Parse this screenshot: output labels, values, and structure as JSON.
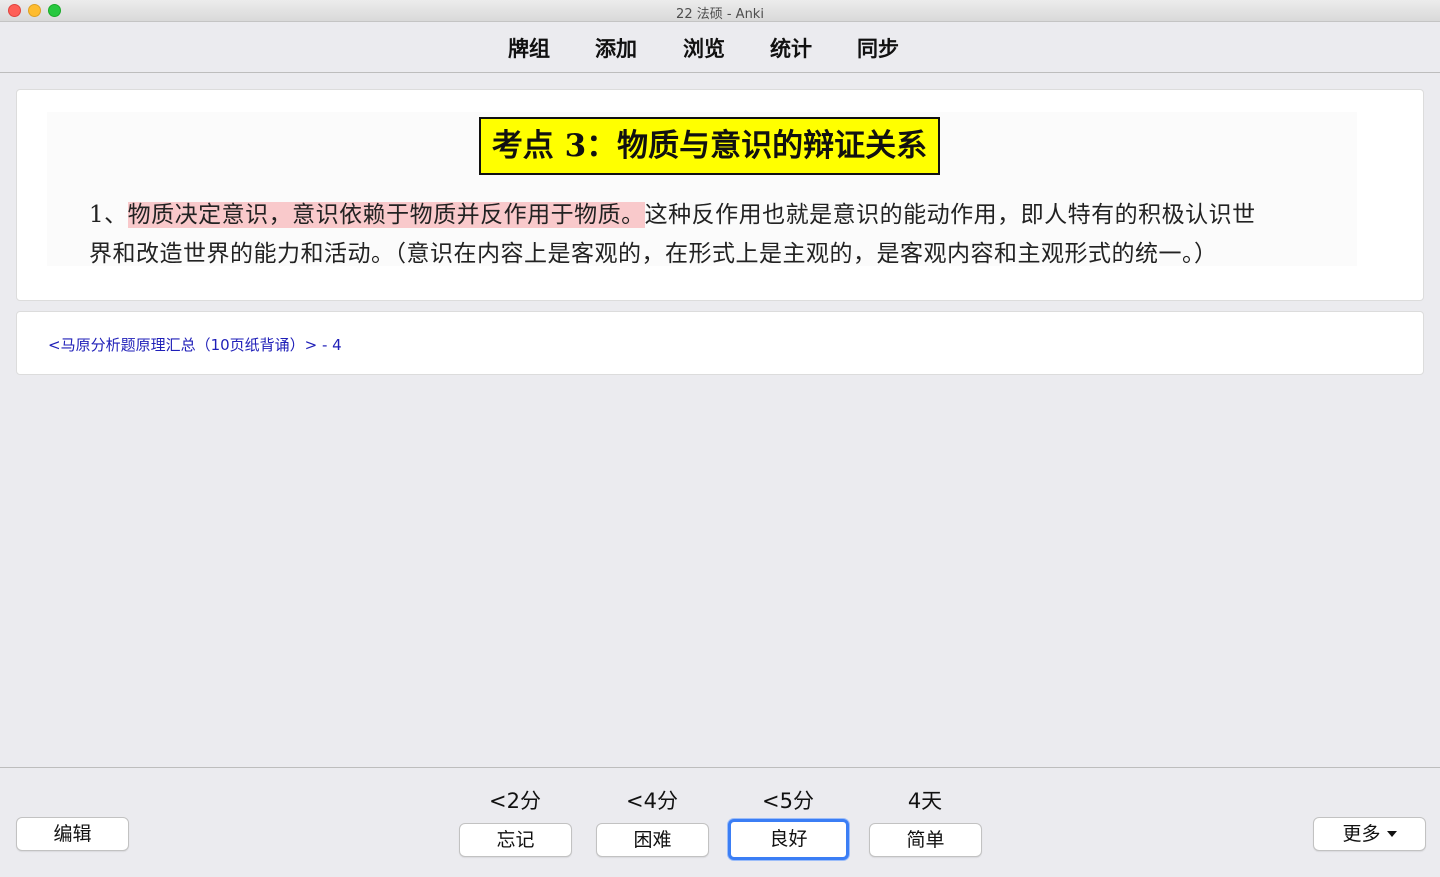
{
  "window": {
    "title": "22 法硕 - Anki"
  },
  "toolbar": {
    "decks": "牌组",
    "add": "添加",
    "browse": "浏览",
    "stats": "统计",
    "sync": "同步"
  },
  "card": {
    "image_title": "考点 3：物质与意识的辩证关系",
    "line1_prefix": "1、",
    "line1_highlight": "物质决定意识，意识依赖于物质并反作用于物质。",
    "line1_rest": "这种反作用也就是意识的能动作用，即人特有的积极认识世",
    "line2": "界和改造世界的能力和活动。（意识在内容上是客观的，在形式上是主观的，是客观内容和主观形式的统一。）",
    "highlight_color": "#f9c9cb",
    "title_highlight_color": "#ffff00"
  },
  "source": {
    "link_text": "<马原分析题原理汇总（10页纸背诵）> - 4",
    "link_color": "#1f1fb8"
  },
  "answer_bar": {
    "edit_label": "编辑",
    "more_label": "更多",
    "buttons": [
      {
        "interval": "<2分",
        "label": "忘记"
      },
      {
        "interval": "<4分",
        "label": "困难"
      },
      {
        "interval": "<5分",
        "label": "良好"
      },
      {
        "interval": "4天",
        "label": "简单"
      }
    ],
    "focus_color": "#3b7ef5"
  }
}
